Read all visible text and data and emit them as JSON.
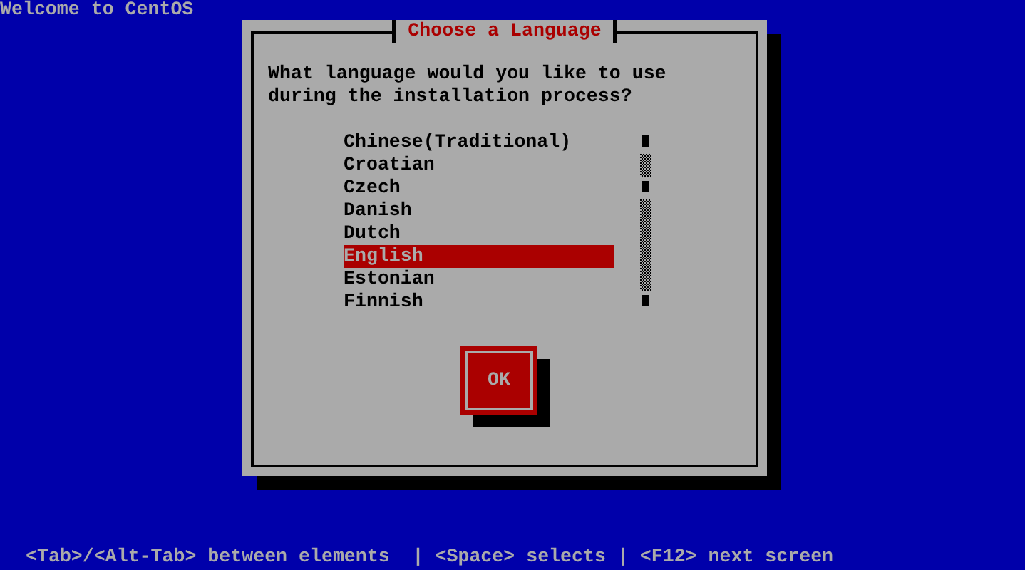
{
  "window": {
    "title": "Welcome to CentOS"
  },
  "dialog": {
    "title": "Choose a Language",
    "prompt": "What language would you like to use\nduring the installation process?",
    "languages": [
      {
        "label": "Chinese(Traditional)",
        "selected": false
      },
      {
        "label": "Croatian",
        "selected": false
      },
      {
        "label": "Czech",
        "selected": false
      },
      {
        "label": "Danish",
        "selected": false
      },
      {
        "label": "Dutch",
        "selected": false
      },
      {
        "label": "English",
        "selected": true
      },
      {
        "label": "Estonian",
        "selected": false
      },
      {
        "label": "Finnish",
        "selected": false
      }
    ],
    "button": "OK"
  },
  "status_bar": "<Tab>/<Alt-Tab> between elements  | <Space> selects | <F12> next screen"
}
